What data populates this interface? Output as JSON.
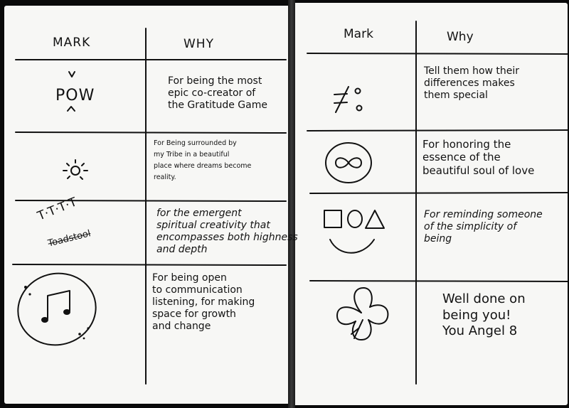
{
  "left_table": {
    "header_mark": "MARK",
    "header_why": "WHY",
    "rows": [
      {
        "mark_text": "POW",
        "why_lines": [
          "For being the most",
          "epic co-creator of",
          "the Gratitude Game"
        ]
      },
      {
        "mark_icon": "sun-icon",
        "why_lines": [
          "For Being surrounded by",
          "my Tribe in a beautiful",
          "place where dreams become",
          "reality."
        ]
      },
      {
        "mark_text": "T·T·T·T",
        "mark_subtext": "Toadstool",
        "why_lines": [
          "for the emergent",
          "spiritual creativity that",
          "encompasses both highness",
          "and depth"
        ]
      },
      {
        "mark_icon": "music-note-icon",
        "why_lines": [
          "For being open",
          "to communication",
          "listening, for making",
          "space for growth",
          "and change"
        ]
      }
    ]
  },
  "right_table": {
    "header_mark": "Mark",
    "header_why": "Why",
    "rows": [
      {
        "mark_icon": "not-equal-icon",
        "why_lines": [
          "Tell them how their",
          "differences makes",
          "them special"
        ]
      },
      {
        "mark_icon": "infinity-icon",
        "why_lines": [
          "For honoring the",
          "essence of the",
          "beautiful soul of love"
        ]
      },
      {
        "mark_icon": "square-circle-triangle-smile-icon",
        "why_lines": [
          "For reminding someone",
          "of the simplicity of",
          "being"
        ]
      },
      {
        "mark_icon": "clover-icon",
        "why_lines": [
          "Well done on",
          "being you!",
          "You Angel 8"
        ]
      }
    ]
  }
}
